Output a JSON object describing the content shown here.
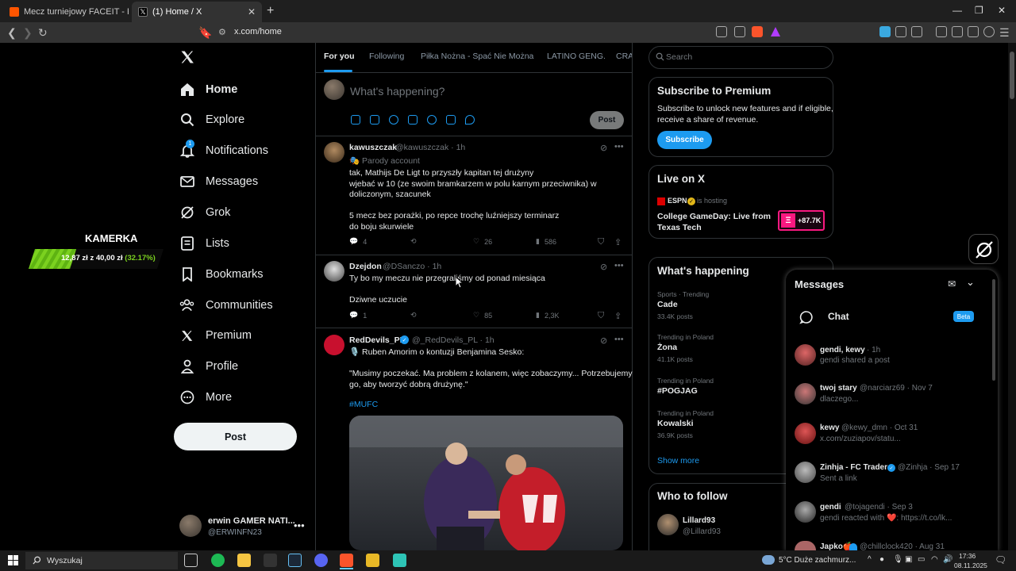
{
  "browser": {
    "tabs": [
      {
        "label": "Mecz turniejowy FACEIT - FACEIT.com"
      },
      {
        "label": "(1) Home / X"
      }
    ],
    "url": "x.com/home"
  },
  "nav": {
    "items": [
      {
        "label": "Home",
        "icon": "home-icon"
      },
      {
        "label": "Explore",
        "icon": "search-icon"
      },
      {
        "label": "Notifications",
        "icon": "bell-icon",
        "badge": "1"
      },
      {
        "label": "Messages",
        "icon": "envelope-icon"
      },
      {
        "label": "Grok",
        "icon": "grok-icon"
      },
      {
        "label": "Lists",
        "icon": "list-icon"
      },
      {
        "label": "Bookmarks",
        "icon": "bookmark-icon"
      },
      {
        "label": "Communities",
        "icon": "people-icon"
      },
      {
        "label": "Premium",
        "icon": "x-icon"
      },
      {
        "label": "Profile",
        "icon": "person-icon"
      },
      {
        "label": "More",
        "icon": "more-circle-icon"
      }
    ],
    "post_label": "Post",
    "account": {
      "name": "erwin GAMER NATI...",
      "handle": "@ERWINFN23"
    }
  },
  "kamerka": {
    "title": "KAMERKA",
    "current": "12,87 zł",
    "of": "z",
    "goal": "40,00 zł",
    "percent_text": "(32.17%)",
    "progress": 0.3217
  },
  "feed": {
    "tabs": [
      "For you",
      "Following",
      "Piłka Nożna - Spać Nie Można",
      "LATINO GENG.",
      "CRA"
    ],
    "compose_placeholder": "What's happening?",
    "post_label": "Post",
    "tweets": [
      {
        "name": "kawuszczak",
        "meta": "@kawuszczak · 1h",
        "badge": "Parody account",
        "text": "tak, Mathijs De Ligt to przyszły kapitan tej drużyny\nwjebać w 10 (ze swoim bramkarzem w polu karnym przeciwnika) w\ndoliczonym, szacunek\n\n5 mecz bez porażki, po repce trochę luźniejszy terminarz\ndo boju skurwiele",
        "replies": "4",
        "reposts": "",
        "likes": "26",
        "views": "586"
      },
      {
        "name": "Dzejdon",
        "meta": "@DSanczo · 1h",
        "text": "Ty bo my meczu nie przegraliśmy od ponad miesiąca\n\nDziwne uczucie",
        "replies": "1",
        "reposts": "",
        "likes": "85",
        "views": "2,3K"
      },
      {
        "name": "RedDevils_PL",
        "meta": "@_RedDevils_PL · 1h",
        "text": "🎙️ Ruben Amorim o kontuzji Benjamina Sesko:\n\n\"Musimy poczekać. Ma problem z kolanem, więc zobaczymy... Potrzebujemy\ngo, aby tworzyć dobrą drużynę.\"",
        "hashtag": "#MUFC"
      }
    ]
  },
  "right": {
    "search_placeholder": "Search",
    "premium": {
      "title": "Subscribe to Premium",
      "text": "Subscribe to unlock new features and if eligible,\nreceive a share of revenue.",
      "button": "Subscribe"
    },
    "live": {
      "title": "Live on X",
      "host": "ESPN",
      "hosting": "is hosting",
      "show": "College GameDay: Live from\nTexas Tech",
      "count": "+87.7K"
    },
    "happening": {
      "title": "What's happening",
      "trends": [
        {
          "cat": "Sports · Trending",
          "name": "Cade",
          "count": "33.4K posts"
        },
        {
          "cat": "Trending in Poland",
          "name": "Żona",
          "count": "41.1K posts"
        },
        {
          "cat": "Trending in Poland",
          "name": "#POGJAG",
          "count": ""
        },
        {
          "cat": "Trending in Poland",
          "name": "Kowalski",
          "count": "36.9K posts"
        }
      ],
      "show_more": "Show more"
    },
    "follow": {
      "title": "Who to follow",
      "users": [
        {
          "name": "Lillard93",
          "handle": "@Lillard93"
        }
      ]
    }
  },
  "messages": {
    "title": "Messages",
    "chat_label": "Chat",
    "beta": "Beta",
    "items": [
      {
        "name": "gendi, kewy",
        "meta": "· 1h",
        "text": "gendi shared a post"
      },
      {
        "name": "twoj stary",
        "meta": "@narciarz69 · Nov 7",
        "text": "dlaczego..."
      },
      {
        "name": "kewy",
        "meta": "@kewy_dmn · Oct 31",
        "text": "x.com/zuziapov/statu..."
      },
      {
        "name": "Zinhja - FC Trader",
        "meta": "@Zinhja · Sep 17",
        "text": "Sent a link"
      },
      {
        "name": "gendi",
        "meta": "@tojagendi · Sep 3",
        "text": "gendi reacted with ❤️: https://t.co/lk..."
      },
      {
        "name": "Japko🍎",
        "meta": "@chillclock420 · Aug 31",
        "text": ""
      }
    ]
  },
  "taskbar": {
    "search": "Wyszukaj",
    "weather": "5°C  Duże zachmurz...",
    "time": "17:36",
    "date": "08.11.2025"
  }
}
